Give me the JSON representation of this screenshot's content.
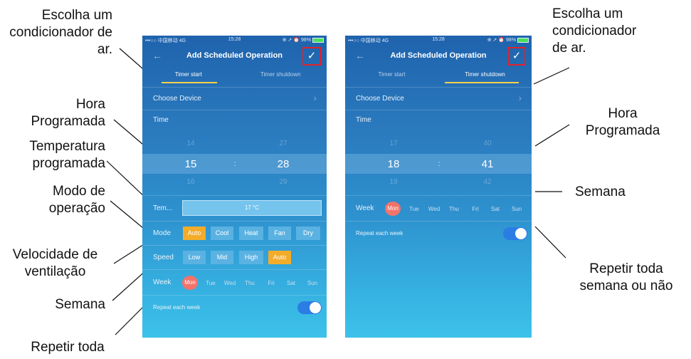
{
  "callouts": {
    "left": {
      "choose_ac": "Escolha um condicionador de ar.",
      "scheduled_time": "Hora Programada",
      "scheduled_temp": "Temperatura programada",
      "mode": "Modo de operação",
      "fan_speed": "Velocidade de ventilação",
      "week": "Semana",
      "repeat": "Repetir toda"
    },
    "right": {
      "choose_ac": "Escolha um condicionador de ar.",
      "scheduled_time": "Hora Programada",
      "week": "Semana",
      "repeat": "Repetir toda semana ou não"
    }
  },
  "status_bar": {
    "carrier": "•••○○ 中国移动 4G",
    "time": "15:28",
    "right": "⊕ ➚ ⏰ 98%"
  },
  "header": {
    "title": "Add Scheduled Operation"
  },
  "tabs": [
    "Timer start",
    "Timer shutdown"
  ],
  "left_screen": {
    "active_tab": "Timer start",
    "choose_device": "Choose Device",
    "time_label": "Time",
    "picker": {
      "hour_prev": "14",
      "hour": "15",
      "hour_next": "16",
      "separator": ":",
      "min_prev": "27",
      "min": "28",
      "min_next": "29"
    },
    "temp": {
      "label": "Tem...",
      "value": "17 °C"
    },
    "mode": {
      "label": "Mode",
      "options": [
        "Auto",
        "Cool",
        "Heat",
        "Fan",
        "Dry"
      ],
      "selected": "Auto"
    },
    "speed": {
      "label": "Speed",
      "options": [
        "Low",
        "Mid",
        "High",
        "Auto"
      ],
      "selected": "Auto"
    },
    "week": {
      "label": "Week",
      "days": [
        "Mon",
        "Tue",
        "Wed",
        "Thu",
        "Fri",
        "Sat",
        "Sun"
      ],
      "selected": "Mon"
    },
    "repeat": {
      "label": "Repeat each week",
      "on": true
    }
  },
  "right_screen": {
    "active_tab": "Timer shutdown",
    "choose_device": "Choose Device",
    "time_label": "Time",
    "picker": {
      "hour_prev": "17",
      "hour": "18",
      "hour_next": "19",
      "separator": ":",
      "min_prev": "40",
      "min": "41",
      "min_next": "42"
    },
    "week": {
      "label": "Week",
      "days": [
        "Mon",
        "Tue",
        "Wed",
        "Thu",
        "Fri",
        "Sat",
        "Sun"
      ],
      "selected": "Mon"
    },
    "repeat": {
      "label": "Repeat each week",
      "on": true
    }
  },
  "colors": {
    "accent_selected": "#f3ac2a",
    "day_selected": "#f2736a",
    "toggle_on": "#2b7de4",
    "highlight_box": "#e0222a"
  }
}
